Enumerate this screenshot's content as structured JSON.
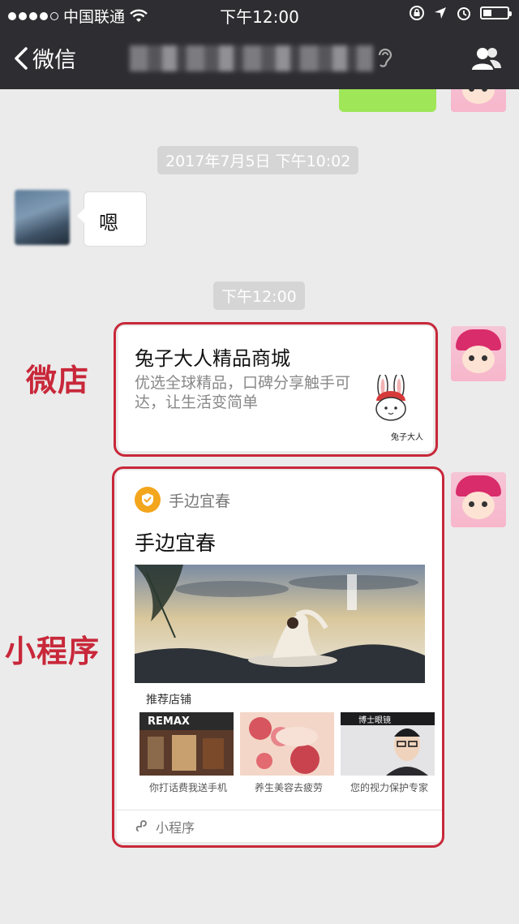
{
  "status_bar": {
    "carrier": "中国联通",
    "time": "下午12:00",
    "battery_level": 0.35
  },
  "nav": {
    "back_label": "微信",
    "icons": [
      "chevron-left-icon",
      "ear-icon",
      "people-icon"
    ]
  },
  "messages": {
    "timestamp_1": "2017年7月5日 下午10:02",
    "incoming_text": "嗯",
    "timestamp_2": "下午12:00"
  },
  "annotations": {
    "weidian": "微店",
    "miniprogram": "小程序"
  },
  "shop_card": {
    "title": "兔子大人精品商城",
    "description": "优选全球精品，口碑分享触手可达，让生活变简单",
    "logo_text": "兔子大人"
  },
  "miniprogram_card": {
    "brand": "手边宜春",
    "title": "手边宜春",
    "section_label": "推荐店铺",
    "items": [
      {
        "caption": "你打话费我送手机",
        "sign": "REMAX"
      },
      {
        "caption": "养生美容去疲劳"
      },
      {
        "caption": "您的视力保护专家",
        "sign": "博士眼镜"
      }
    ],
    "footer_label": "小程序"
  },
  "colors": {
    "nav_bg": "#2e2e32",
    "chat_bg": "#ebebeb",
    "annotation_red": "#c8283a",
    "badge_orange": "#f3a51c",
    "sent_green": "#9fe658"
  }
}
